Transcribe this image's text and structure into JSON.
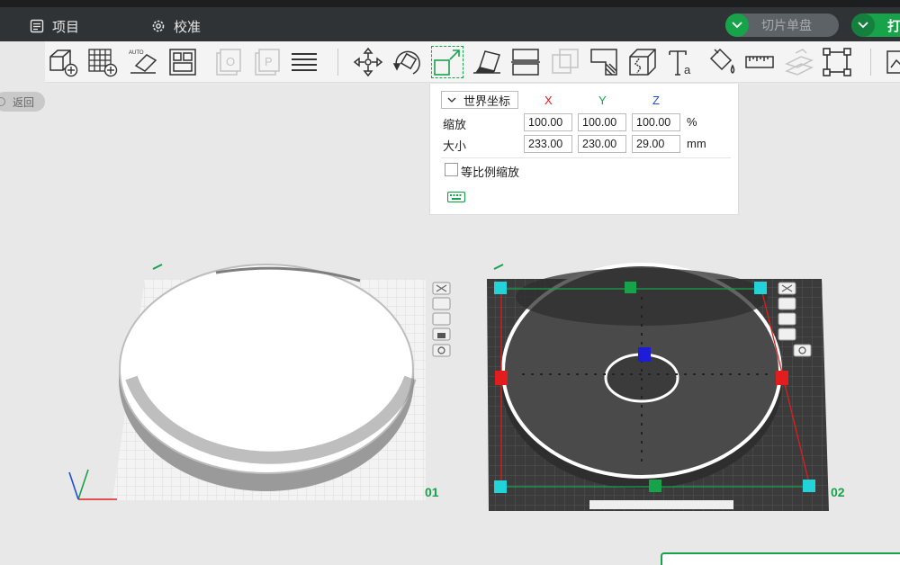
{
  "titlebar": {
    "project_label": "项目",
    "calibrate_label": "校准",
    "slice_label": "切片单盘",
    "print_label": "打"
  },
  "back_label": "返回",
  "toolbar": {
    "tools": [
      "add-object-icon",
      "add-plate-icon",
      "auto-orient-icon",
      "arrange-icon",
      "plate-clone-icon",
      "plate-pause-icon",
      "layer-list-icon",
      "move-icon",
      "rotate-icon",
      "scale-icon",
      "lay-on-face-icon",
      "split-icon",
      "boolean-icon",
      "cut-icon",
      "split-object-icon",
      "text-icon",
      "paint-bucket-icon",
      "measure-icon",
      "assembly-icon",
      "fit-view-icon",
      "more-icon"
    ]
  },
  "scale_panel": {
    "coord_system": "世界坐标",
    "axis_x": "X",
    "axis_y": "Y",
    "axis_z": "Z",
    "scale_label": "缩放",
    "size_label": "大小",
    "scale_x": "100.00",
    "scale_y": "100.00",
    "scale_z": "100.00",
    "scale_unit": "%",
    "size_x": "233.00",
    "size_y": "230.00",
    "size_z": "29.00",
    "size_unit": "mm",
    "uniform_label": "等比例缩放",
    "uniform_checked": false
  },
  "plates": {
    "plate1_label": "01",
    "plate2_label": "02"
  },
  "colors": {
    "accent": "#16a34a",
    "axis_x": "#e11d1d",
    "axis_y": "#16a34a",
    "axis_z": "#1d4ed8"
  }
}
